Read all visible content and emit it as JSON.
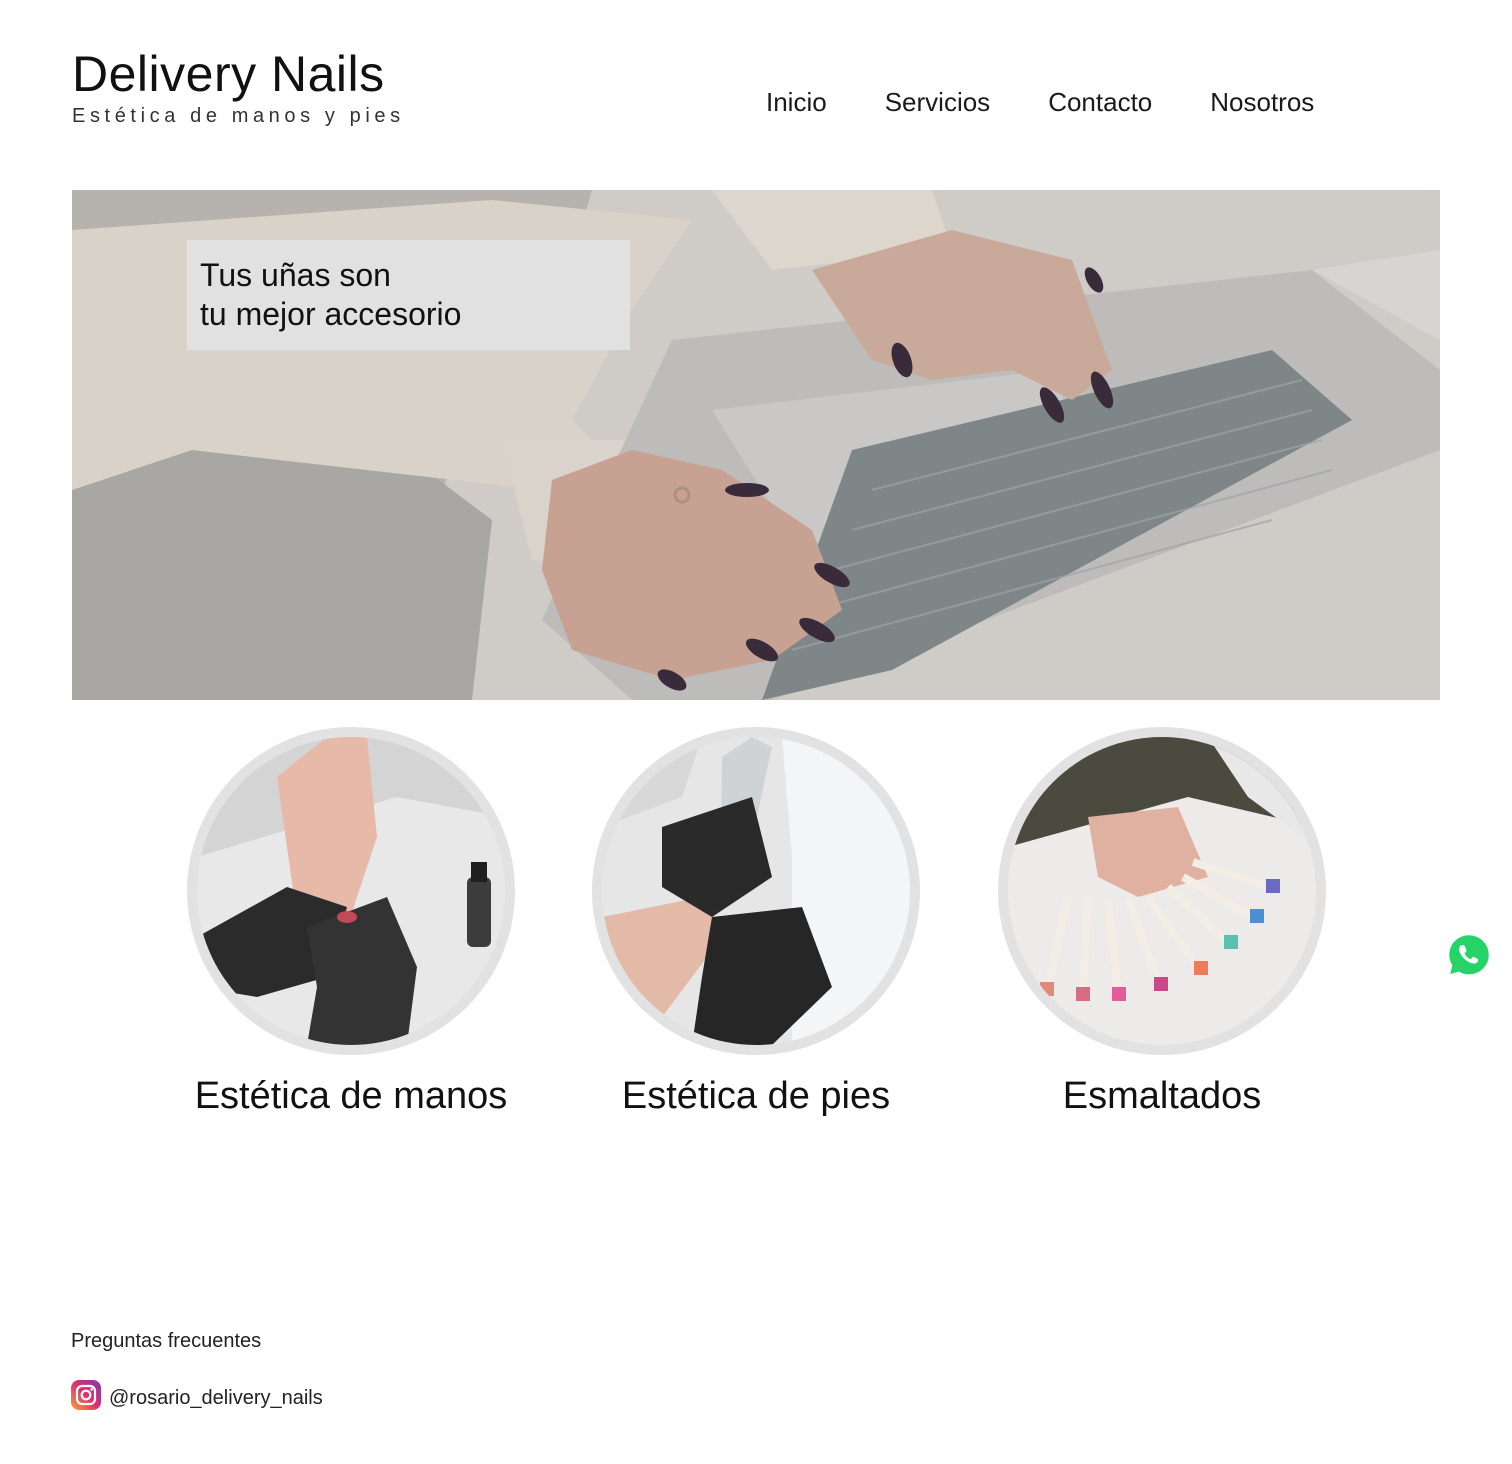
{
  "header": {
    "title": "Delivery Nails",
    "subtitle": "Estética de manos y pies"
  },
  "nav": {
    "items": [
      {
        "label": "Inicio"
      },
      {
        "label": "Servicios"
      },
      {
        "label": "Contacto"
      },
      {
        "label": "Nosotros"
      }
    ]
  },
  "hero": {
    "line1": "Tus uñas son",
    "line2": "tu mejor accesorio"
  },
  "services": [
    {
      "label": "Estética de manos"
    },
    {
      "label": "Estética de pies"
    },
    {
      "label": "Esmaltados"
    }
  ],
  "footer": {
    "faq": "Preguntas frecuentes",
    "instagram_handle": "@rosario_delivery_nails"
  },
  "icons": {
    "instagram": "instagram-icon",
    "whatsapp": "whatsapp-icon"
  },
  "colors": {
    "caption_bg": "#e1e1e1",
    "circle_ring": "#e2e2e2",
    "whatsapp": "#25d366"
  }
}
